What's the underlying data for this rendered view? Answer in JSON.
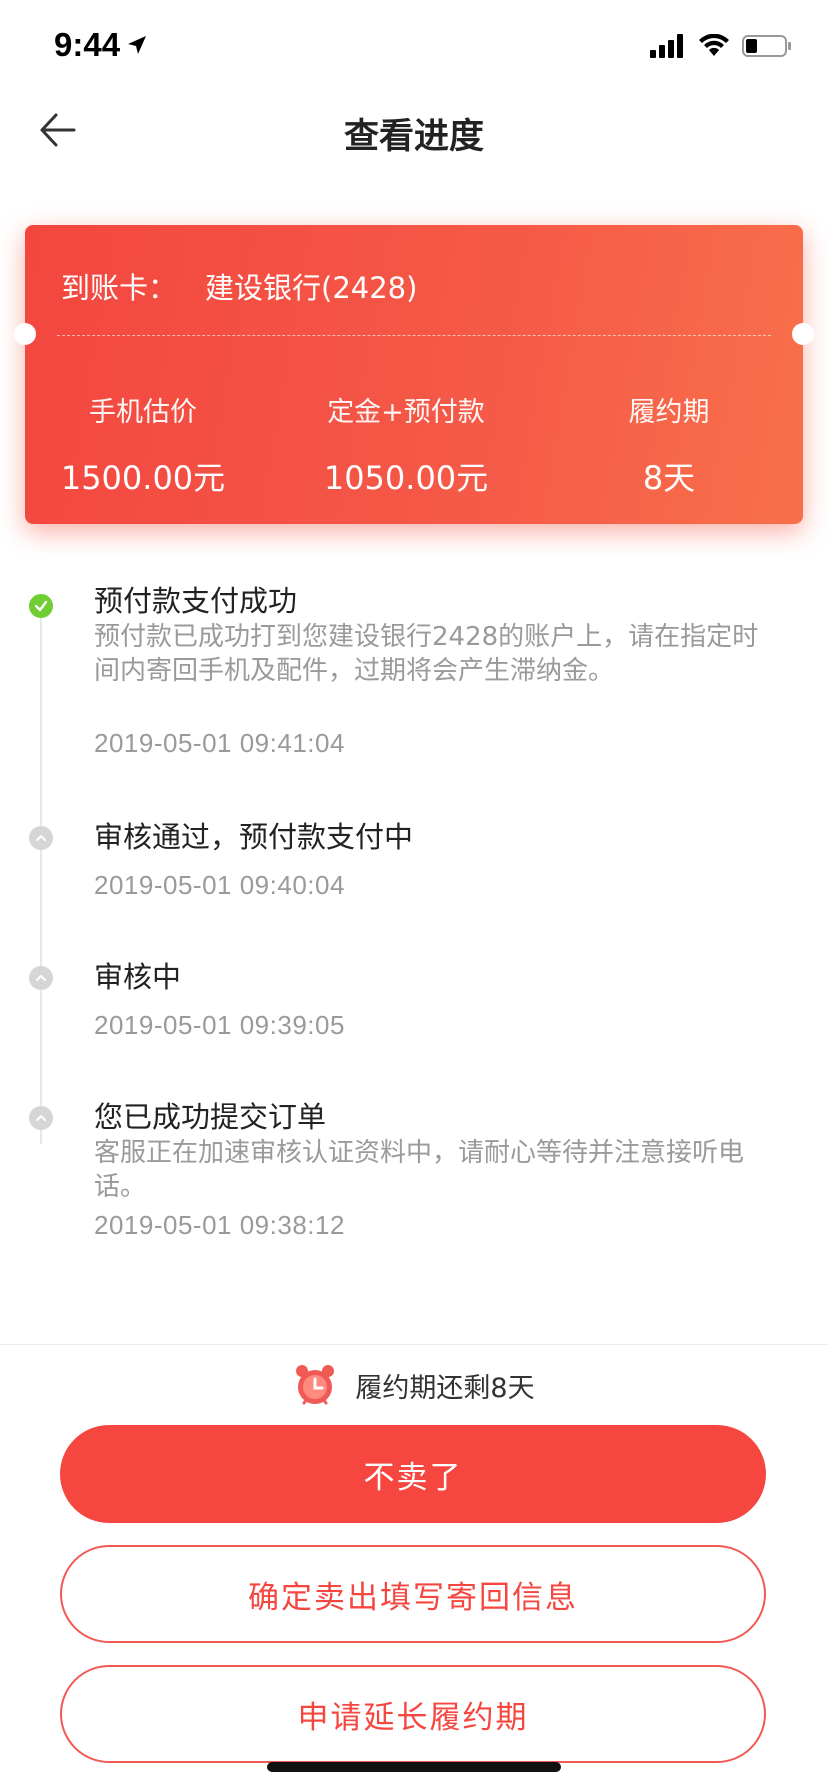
{
  "status_bar": {
    "time": "9:44"
  },
  "nav": {
    "title": "查看进度"
  },
  "card": {
    "account_label": "到账卡：",
    "account_value": "建设银行(2428)",
    "columns": [
      {
        "label": "手机估价",
        "value": "1500.00元"
      },
      {
        "label": "定金+预付款",
        "value": "1050.00元"
      },
      {
        "label": "履约期",
        "value": "8天"
      }
    ]
  },
  "timeline": [
    {
      "status": "done",
      "title": "预付款支付成功",
      "desc": "预付款已成功打到您建设银行2428的账户上，请在指定时间内寄回手机及配件，过期将会产生滞纳金。",
      "time": "2019-05-01 09:41:04"
    },
    {
      "status": "pending",
      "title": "审核通过，预付款支付中",
      "desc": "",
      "time": "2019-05-01 09:40:04"
    },
    {
      "status": "pending",
      "title": "审核中",
      "desc": "",
      "time": "2019-05-01 09:39:05"
    },
    {
      "status": "pending",
      "title": "您已成功提交订单",
      "desc": "客服正在加速审核认证资料中，请耐心等待并注意接听电话。",
      "time": "2019-05-01 09:38:12"
    }
  ],
  "deadline": {
    "icon": "alarm-clock-icon",
    "text": "履约期还剩8天"
  },
  "buttons": {
    "primary": "不卖了",
    "confirm": "确定卖出填写寄回信息",
    "extend": "申请延长履约期"
  },
  "colors": {
    "accent": "#f54640",
    "done": "#6fce31",
    "pending": "#d6d6d6"
  }
}
